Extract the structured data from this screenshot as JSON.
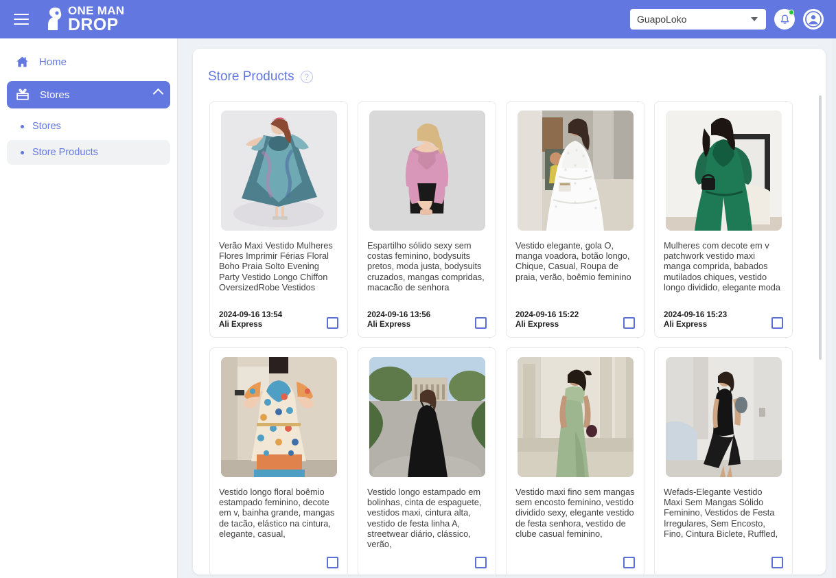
{
  "header": {
    "menu_icon": "hamburger-menu-icon",
    "logo_line1": "ONE MAN",
    "logo_line2": "DROP",
    "store_selector_value": "GuapoLoko",
    "notification_icon": "bell-icon",
    "account_icon": "account-circle-icon",
    "accent_color": "#6277e0",
    "notification_dot_color": "#20c933"
  },
  "sidebar": {
    "items": [
      {
        "label": "Home",
        "icon": "home-icon",
        "active": false
      },
      {
        "label": "Stores",
        "icon": "store-icon",
        "active": true,
        "expand_icon": "chevron-up-icon"
      }
    ],
    "sub_items": [
      {
        "label": "Stores",
        "selected": false
      },
      {
        "label": "Store Products",
        "selected": true
      }
    ]
  },
  "main": {
    "title": "Store Products",
    "help_icon": "help-circle-icon",
    "help_glyph": "?",
    "products": [
      {
        "title": "Verão Maxi Vestido Mulheres Flores Imprimir Férias Floral Boho Praia Solto Evening Party Vestido Longo Chiffon OversizedRobe Vestidos",
        "timestamp": "2024-09-16 13:54",
        "source": "Ali Express",
        "selected": false,
        "image": "floral-teal-maxi-dress-photo"
      },
      {
        "title": "Espartilho sólido sexy sem costas feminino, bodysuits pretos, moda justa, bodysuits cruzados, mangas compridas, macacão de senhora",
        "timestamp": "2024-09-16 13:56",
        "source": "Ali Express",
        "selected": false,
        "image": "pink-off-shoulder-bodysuit-photo"
      },
      {
        "title": "Vestido elegante, gola O, manga voadora, botão longo, Chique, Casual, Roupa de praia, verão, boêmio feminino",
        "timestamp": "2024-09-16 15:22",
        "source": "Ali Express",
        "selected": false,
        "image": "white-eyelet-maxi-dress-photo"
      },
      {
        "title": "Mulheres com decote em v patchwork vestido maxi manga comprida, babados mutilados chiques, vestido longo dividido, elegante moda",
        "timestamp": "2024-09-16 15:23",
        "source": "Ali Express",
        "selected": false,
        "image": "green-vneck-maxi-dress-photo"
      },
      {
        "title": "Vestido longo floral boêmio estampado feminino, decote em v, bainha grande, mangas de tacão, elástico na cintura, elegante, casual,",
        "timestamp": "",
        "source": "",
        "selected": false,
        "image": "floral-boho-print-dress-photo"
      },
      {
        "title": "Vestido longo estampado em bolinhas, cinta de espaguete, vestidos maxi, cintura alta, vestido de festa linha A, streetwear diário, clássico, verão,",
        "timestamp": "",
        "source": "",
        "selected": false,
        "image": "black-strap-maxi-dress-outdoor-photo"
      },
      {
        "title": "Vestido maxi fino sem mangas sem encosto feminino, vestido dividido sexy, elegante vestido de festa senhora, vestido de clube casual feminino,",
        "timestamp": "",
        "source": "",
        "selected": false,
        "image": "sage-one-shoulder-gown-photo"
      },
      {
        "title": "Wefads-Elegante Vestido Maxi Sem Mangas Sólido Feminino, Vestidos de Festa Irregulares, Sem Encosto, Fino, Cintura Biclete, Ruffled,",
        "timestamp": "",
        "source": "",
        "selected": false,
        "image": "black-ruffled-midi-dress-photo"
      }
    ]
  }
}
